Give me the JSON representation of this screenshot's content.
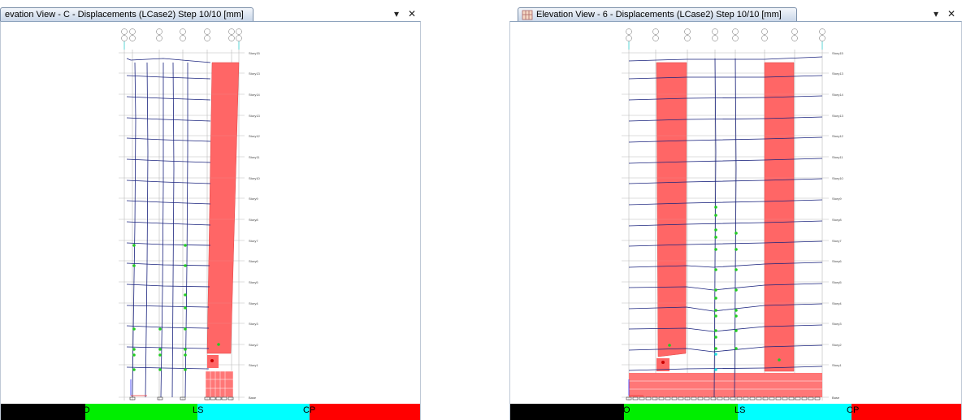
{
  "left_pane": {
    "title": "evation View - C  - Displacements (LCase2)  Step 10/10  [mm]",
    "grid_bubbles_top": [
      "1",
      "2",
      "3",
      "4",
      "5",
      "6",
      "7",
      "8",
      "9"
    ],
    "grid_bubbles_bottom": [
      "A",
      "B",
      "C",
      "D",
      "E",
      "F",
      "G",
      "H",
      "I"
    ],
    "story_labels": [
      "Story15",
      "Story13",
      "Story14",
      "Story13",
      "Story12",
      "Story11",
      "Story10",
      "Story9",
      "Story8",
      "Story7",
      "Story6",
      "Story5",
      "Story4",
      "Story3",
      "Story2",
      "Story1",
      "Base"
    ],
    "legend": {
      "o": "IO",
      "ls": "LS",
      "cp": "CP"
    }
  },
  "right_pane": {
    "title": "Elevation View - 6  - Displacements (LCase2)  Step 10/10  [mm]",
    "grid_bubbles_top": [
      "B",
      "B",
      "B",
      "C",
      "D",
      "E",
      "F",
      "G"
    ],
    "grid_bubbles_bottom": [
      "A",
      "B",
      "C",
      "D",
      "E",
      "F",
      "G",
      "H"
    ],
    "story_labels": [
      "Story15",
      "Story13",
      "Story14",
      "Story13",
      "Story12",
      "Story11",
      "Story10",
      "Story9",
      "Story8",
      "Story7",
      "Story6",
      "Story5",
      "Story4",
      "Story3",
      "Story2",
      "Story1",
      "Base"
    ],
    "legend": {
      "o": "IO",
      "ls": "LS",
      "cp": "CP"
    }
  },
  "window_controls": {
    "menu": "▾",
    "close": "✕"
  },
  "legend_colors": {
    "black": "#000000",
    "green": "#00ee00",
    "cyan": "#00ffff",
    "red": "#ff0000"
  },
  "icons": [
    "dropdown-arrow-icon",
    "close-icon",
    "elevation-view-icon"
  ]
}
